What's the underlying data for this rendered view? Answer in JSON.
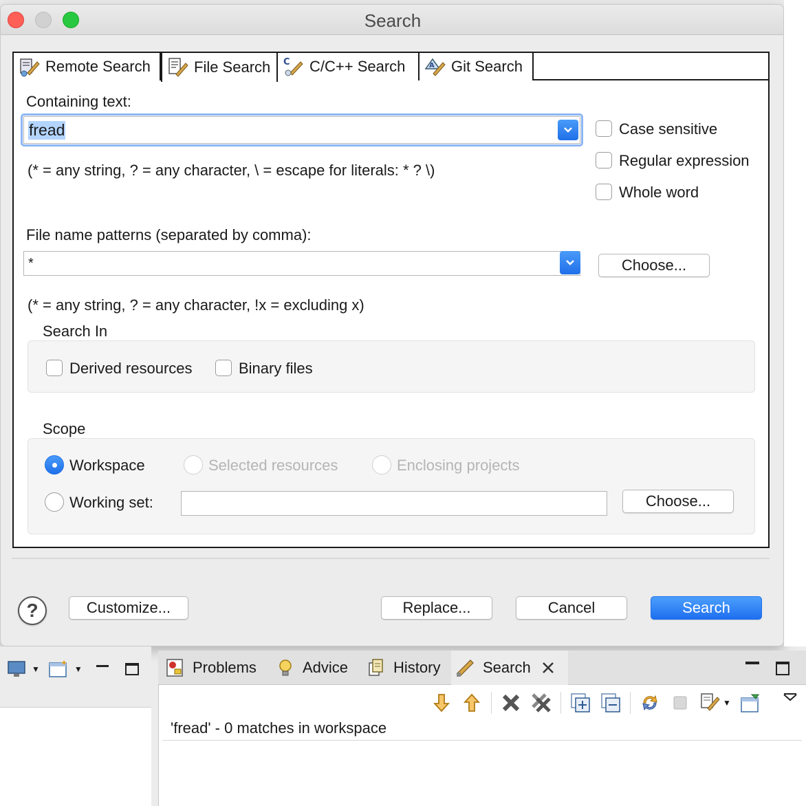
{
  "dialog": {
    "title": "Search",
    "tabs": [
      {
        "label": "Remote Search",
        "icon": "remote-search-icon"
      },
      {
        "label": "File Search",
        "icon": "file-search-icon",
        "active": true
      },
      {
        "label": "C/C++ Search",
        "icon": "cpp-search-icon"
      },
      {
        "label": "Git Search",
        "icon": "git-search-icon"
      }
    ],
    "containing_text_label": "Containing text:",
    "containing_text_value": "fread",
    "containing_hint": "(* = any string, ? = any character, \\ = escape for literals: * ? \\)",
    "options": {
      "case_sensitive": "Case sensitive",
      "regular_expression": "Regular expression",
      "whole_word": "Whole word"
    },
    "file_patterns_label": "File name patterns (separated by comma):",
    "file_patterns_value": "*",
    "choose_label": "Choose...",
    "file_patterns_hint": "(* = any string, ? = any character, !x = excluding x)",
    "search_in": {
      "title": "Search In",
      "derived": "Derived resources",
      "binary": "Binary files"
    },
    "scope": {
      "title": "Scope",
      "workspace": "Workspace",
      "selected_resources": "Selected resources",
      "enclosing_projects": "Enclosing projects",
      "working_set": "Working set:",
      "working_set_value": "",
      "choose_label": "Choose..."
    },
    "buttons": {
      "customize": "Customize...",
      "replace": "Replace...",
      "cancel": "Cancel",
      "search": "Search"
    }
  },
  "views": {
    "tabs": [
      {
        "label": "Problems",
        "icon": "problems-icon"
      },
      {
        "label": "Advice",
        "icon": "lightbulb-icon"
      },
      {
        "label": "History",
        "icon": "history-icon"
      },
      {
        "label": "Search",
        "icon": "search-view-icon",
        "active": true
      }
    ],
    "result_text": "'fread' - 0 matches in workspace"
  },
  "colors": {
    "accent": "#1f6fe9",
    "close_red": "#fe5f57",
    "minimize_gray": "#d1d1d1",
    "maximize_green": "#28c840"
  }
}
